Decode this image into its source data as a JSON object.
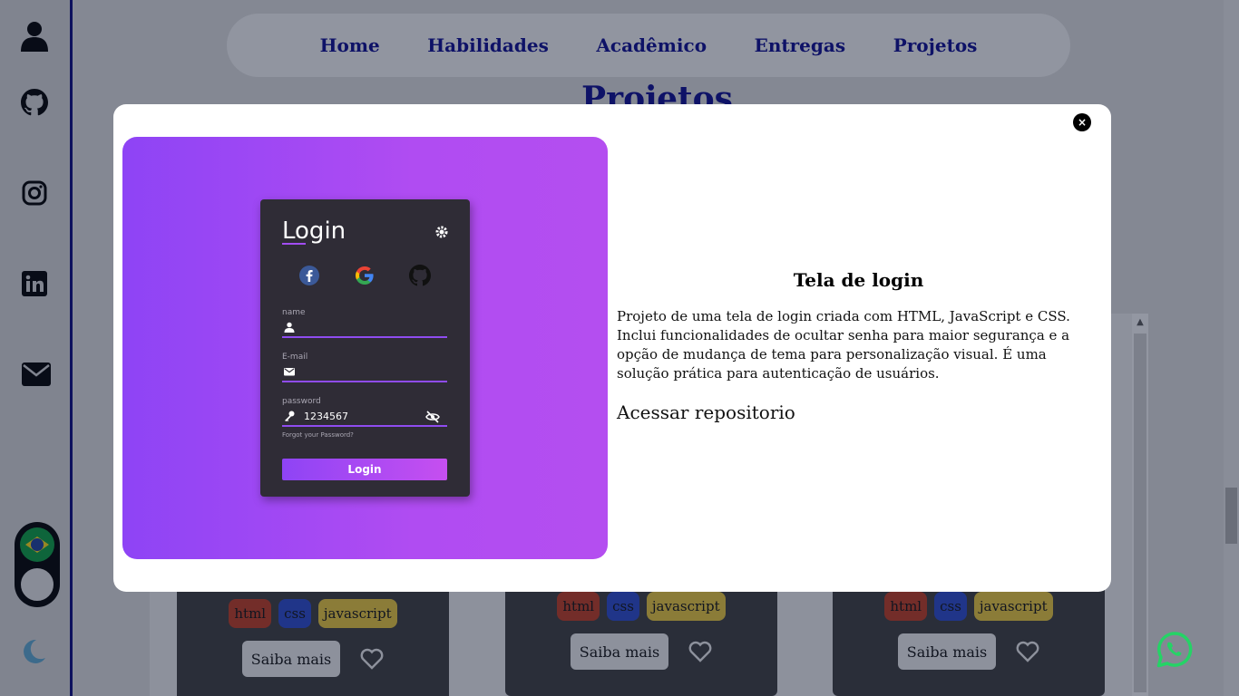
{
  "sidebar": {
    "icons": [
      "user-icon",
      "github-icon",
      "instagram-icon",
      "linkedin-icon",
      "mail-icon"
    ],
    "language_toggle": "brazil-flag",
    "theme_toggle": "moon-icon"
  },
  "nav": {
    "items": [
      {
        "label": "Home"
      },
      {
        "label": "Habilidades"
      },
      {
        "label": "Acadêmico"
      },
      {
        "label": "Entregas"
      },
      {
        "label": "Projetos"
      }
    ]
  },
  "section": {
    "title": "Projetos"
  },
  "cards": [
    {
      "tags": [
        "html",
        "css",
        "javascript"
      ],
      "more_label": "Saiba mais"
    },
    {
      "tags": [
        "html",
        "css",
        "javascript"
      ],
      "more_label": "Saiba mais"
    },
    {
      "tags": [
        "html",
        "css",
        "javascript"
      ],
      "more_label": "Saiba mais"
    }
  ],
  "modal": {
    "close_label": "×",
    "preview": {
      "title": "Login",
      "name_label": "name",
      "email_label": "E-mail",
      "password_label": "password",
      "password_value": "1234567",
      "forgot": "Forgot your Password?",
      "button": "Login"
    },
    "title": "Tela de login",
    "description": "Projeto de uma tela de login criada com HTML, JavaScript e CSS. Inclui funcionalidades de ocultar senha para maior segurança e a opção de mudança de tema para personalização visual. É uma solução prática para autenticação de usuários.",
    "link_label": "Acessar repositorio"
  },
  "colors": {
    "nav_text": "#0b0b8a",
    "accent_purple": "#8e44f5",
    "tag_html": "#b8391f",
    "tag_css": "#2a48c4",
    "tag_js": "#e2c23a",
    "whatsapp": "#25d366"
  }
}
